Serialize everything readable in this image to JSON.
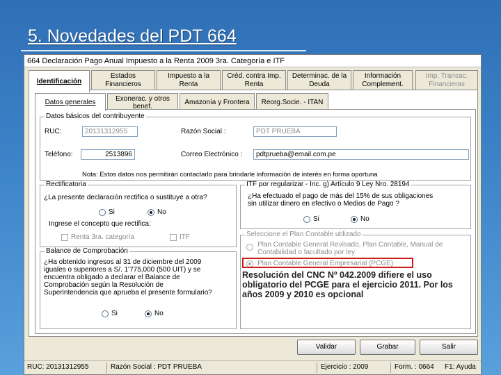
{
  "slide": {
    "title": "5. Novedades del PDT 664"
  },
  "window": {
    "title": "664 Declaración Pago Anual Impuesto a la Renta 2009 3ra. Categoría e ITF"
  },
  "tabs": [
    {
      "label": "Identificación"
    },
    {
      "line1": "Estados",
      "line2": "Financieros"
    },
    {
      "line1": "Impuesto a la",
      "line2": "Renta"
    },
    {
      "line1": "Créd. contra Imp.",
      "line2": "Renta"
    },
    {
      "line1": "Determinac. de la",
      "line2": "Deuda"
    },
    {
      "line1": "Información",
      "line2": "Complement."
    },
    {
      "line1": "Imp. Transac.",
      "line2": "Financieras"
    }
  ],
  "subtabs": [
    {
      "label": "Datos generales"
    },
    {
      "line1": "Exonerac. y otros",
      "line2": "benef."
    },
    {
      "label": "Amazonía y Frontera"
    },
    {
      "label": "Reorg.Socie. - ITAN"
    }
  ],
  "datos_basicos": {
    "group_label": "Datos básicos del contribuyente",
    "ruc_label": "RUC:",
    "ruc_value": "20131312955",
    "razon_label": "Razón Social :",
    "razon_value": "PDT PRUEBA",
    "telefono_label": "Teléfono:",
    "telefono_value": "2513896",
    "correo_label": "Correo Electrónico :",
    "correo_value": "pdtprueba@email.com.pe",
    "note": "Nota: Estos datos nos permitirán contactarlo para brindarle información de interés en forma oportuna"
  },
  "rectificatoria": {
    "group_label": "Rectificatoria",
    "question": "¿La presente declaración rectifica o sustituye a otra?",
    "si": "Si",
    "no": "No",
    "concepto_label": "Ingrese el concepto que rectifica:",
    "opt1": "Renta 3ra. categoría",
    "opt2": "ITF"
  },
  "itf": {
    "group_label": "ITF por regularizar - Inc. g) Artículo 9 Ley Nro. 28194",
    "question_line1": "¿Ha efectuado el pago de más del 15% de sus obligaciones",
    "question_line2": "sin utilizar dinero en efectivo o Medios de Pago ?",
    "si": "Si",
    "no": "No"
  },
  "plan_contable": {
    "group_label": "Seleccione el Plan Contable utilizado",
    "opt1_line1": "Plan Contable General Revisado, Plan Contable, Manual de",
    "opt1_line2": "Contabilidad o facultado por ley",
    "opt2": "Plan Contable General Empresarial (PCGE)",
    "note": "Resolución del CNC Nº 042.2009 difiere el uso obligatorio del PCGE para el ejercicio 2011. Por los años 2009 y 2010 es opcional"
  },
  "balance": {
    "group_label": "Balance de Comprobación",
    "question_lines": [
      "¿Ha obtenido ingresos al 31 de diciembre del 2009",
      "iguales o superiores a S/. 1'775,000 (500 UIT) y se",
      "encuentra obligado a declarar el Balance de",
      "Comprobación según la Resolución de",
      "Superintendencia que aprueba el presente formulario?"
    ],
    "si": "Si",
    "no": "No"
  },
  "buttons": {
    "validar": "Validar",
    "grabar": "Grabar",
    "salir": "Salir"
  },
  "statusbar": {
    "ruc": "RUC: 20131312955",
    "razon": "Razón Social : PDT PRUEBA",
    "ejercicio": "Ejercicio : 2009",
    "form": "Form. : 0664",
    "ayuda": "F1: Ayuda"
  }
}
